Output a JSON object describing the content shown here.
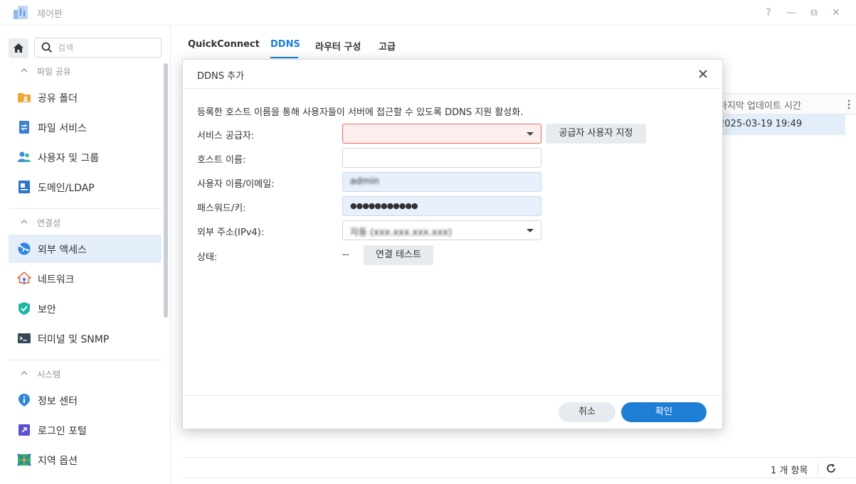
{
  "window": {
    "title": "제어판",
    "controls": [
      "?",
      "—",
      "⧉",
      "✕"
    ]
  },
  "sidebar": {
    "search_placeholder": "검색",
    "sections": [
      {
        "label": "파일 공유",
        "items": [
          {
            "label": "공유 폴더",
            "icon": "shared-folder-icon"
          },
          {
            "label": "파일 서비스",
            "icon": "file-services-icon"
          },
          {
            "label": "사용자 및 그룹",
            "icon": "user-group-icon"
          },
          {
            "label": "도메인/LDAP",
            "icon": "domain-ldap-icon"
          }
        ]
      },
      {
        "label": "연결성",
        "items": [
          {
            "label": "외부 액세스",
            "icon": "external-access-icon",
            "active": true
          },
          {
            "label": "네트워크",
            "icon": "network-icon"
          },
          {
            "label": "보안",
            "icon": "security-shield-icon"
          },
          {
            "label": "터미널 및 SNMP",
            "icon": "terminal-icon"
          }
        ]
      },
      {
        "label": "시스템",
        "items": [
          {
            "label": "정보 센터",
            "icon": "info-center-icon"
          },
          {
            "label": "로그인 포털",
            "icon": "login-portal-icon"
          },
          {
            "label": "지역 옵션",
            "icon": "regional-options-icon"
          }
        ]
      }
    ]
  },
  "tabs": [
    {
      "label": "QuickConnect"
    },
    {
      "label": "DDNS",
      "active": true
    },
    {
      "label": "라우터 구성"
    },
    {
      "label": "고급"
    }
  ],
  "grid": {
    "columns": [
      "마지막 업데이트 시간"
    ],
    "rows": [
      {
        "last_update": "2025-03-19 19:49"
      }
    ],
    "footer_count": "1 개 항목"
  },
  "dialog": {
    "title": "DDNS 추가",
    "description": "등록한 호스트 이름을 통해 사용자들이 서버에 접근할 수 있도록 DDNS 지원 활성화.",
    "fields": {
      "provider": {
        "label": "서비스 공급자:",
        "value": ""
      },
      "hostname": {
        "label": "호스트 이름:",
        "value": ""
      },
      "username": {
        "label": "사용자 이름/이메일:",
        "value": "admin"
      },
      "password": {
        "label": "패스워드/키:",
        "value": "●●●●●●●●●●●"
      },
      "external_address": {
        "label": "외부 주소(IPv4):",
        "value": "자동 (xxx.xxx.xxx.xxx)"
      },
      "status": {
        "label": "상태:",
        "value": "--"
      }
    },
    "custom_provider_button": "공급자 사용자 지정",
    "test_connection_button": "연결 테스트",
    "cancel_button": "취소",
    "ok_button": "확인"
  },
  "colors": {
    "accent": "#1e7ed6",
    "active_bg": "#e3eefa",
    "error_border": "#e36b6b",
    "error_bg": "#fdeeee"
  }
}
